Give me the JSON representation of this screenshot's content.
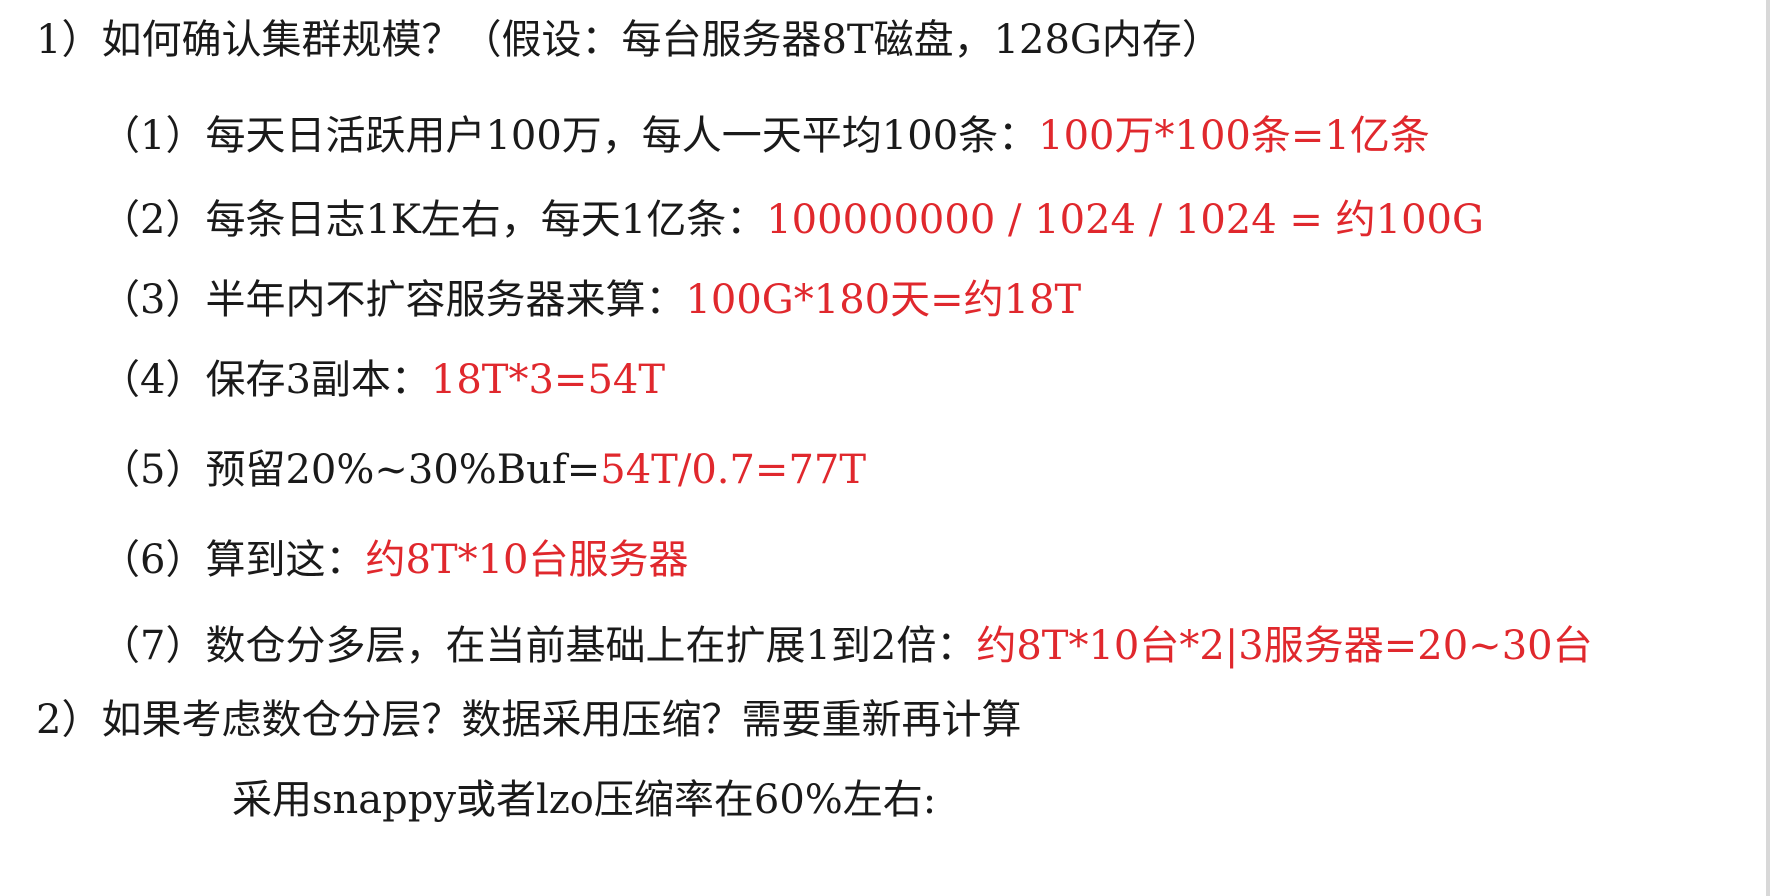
{
  "lines": [
    {
      "text": "1）如何确认集群规模？（假设：每台服务器8T磁盘，128G内存）"
    },
    {
      "text": "（1）每天日活跃用户100万，每人一天平均100条：",
      "red": "100万*100条=1亿条"
    },
    {
      "text": "（2）每条日志1K左右，每天1亿条：",
      "red": "100000000 / 1024 / 1024 = 约100G"
    },
    {
      "text": "（3）半年内不扩容服务器来算：",
      "red": "100G*180天=约18T"
    },
    {
      "text": "（4）保存3副本：",
      "red": "18T*3=54T"
    },
    {
      "text": "（5）预留20%~30%Buf=",
      "red": "54T/0.7=77T"
    },
    {
      "text": "（6）算到这：",
      "red": "约8T*10台服务器"
    },
    {
      "text": "（7）数仓分多层，在当前基础上在扩展1到2倍：",
      "red": "约8T*10台*2|3服务器=20~30台"
    },
    {
      "text": "2）如果考虑数仓分层？数据采用压缩？需要重新再计算"
    },
    {
      "text": "采用snappy或者lzo压缩率在60%左右:"
    }
  ],
  "colors": {
    "text": "#1a1a1a",
    "highlight": "#e0282d",
    "background": "#ffffff"
  }
}
